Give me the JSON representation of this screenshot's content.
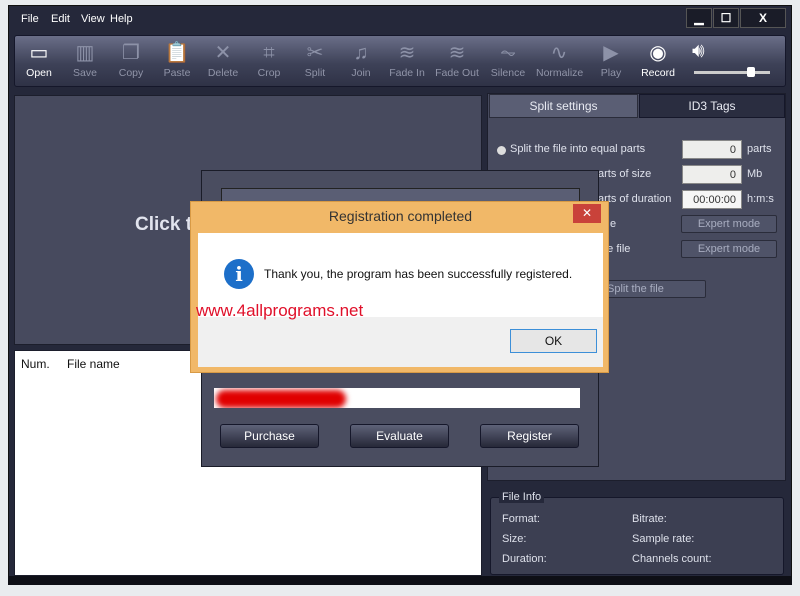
{
  "menu": [
    "File",
    "Edit",
    "View",
    "Help"
  ],
  "window_controls": {
    "minimize": "▁",
    "maximize": "☐",
    "close": "X"
  },
  "toolbar": [
    {
      "label": "Open",
      "icon": "folder-icon",
      "glyph": "▭",
      "enabled": true
    },
    {
      "label": "Save",
      "icon": "save-icon",
      "glyph": "▥",
      "enabled": false
    },
    {
      "label": "Copy",
      "icon": "copy-icon",
      "glyph": "❐",
      "enabled": false
    },
    {
      "label": "Paste",
      "icon": "paste-icon",
      "glyph": "📋",
      "enabled": false
    },
    {
      "label": "Delete",
      "icon": "delete-icon",
      "glyph": "✕",
      "enabled": false
    },
    {
      "label": "Crop",
      "icon": "crop-icon",
      "glyph": "⌗",
      "enabled": false
    },
    {
      "label": "Split",
      "icon": "scissors-icon",
      "glyph": "✂",
      "enabled": false
    },
    {
      "label": "Join",
      "icon": "join-icon",
      "glyph": "♫",
      "enabled": false
    },
    {
      "label": "Fade In",
      "icon": "fade-in-icon",
      "glyph": "≋",
      "enabled": false
    },
    {
      "label": "Fade Out",
      "icon": "fade-out-icon",
      "glyph": "≋",
      "enabled": false
    },
    {
      "label": "Silence",
      "icon": "silence-icon",
      "glyph": "⏦",
      "enabled": false
    },
    {
      "label": "Normalize",
      "icon": "normalize-icon",
      "glyph": "∿",
      "enabled": false
    },
    {
      "label": "Play",
      "icon": "play-icon",
      "glyph": "▶",
      "enabled": false
    },
    {
      "label": "Record",
      "icon": "record-icon",
      "glyph": "◉",
      "enabled": true
    }
  ],
  "volume": {
    "icon": "speaker-icon",
    "level": 0.75
  },
  "left_panel": {
    "prompt_fragment": "Click t"
  },
  "file_list": {
    "columns": [
      "Num.",
      "File name"
    ]
  },
  "right_panel": {
    "tabs": [
      "Split settings",
      "ID3 Tags"
    ],
    "active_tab": "Split settings",
    "option1": "Split the file into equal parts",
    "option2_fragment": "arts of size",
    "option3_fragment": "arts of duration",
    "option4_fragment": "e",
    "option5_fragment": "the file",
    "parts_value": "0",
    "parts_unit": "parts",
    "size_value": "0",
    "size_unit": "Mb",
    "duration_value": "00:00:00",
    "duration_unit": "h:m:s",
    "expert1": "Expert mode",
    "expert2": "Expert mode",
    "split_button": "Split the file"
  },
  "file_info": {
    "title": "File Info",
    "format": "Format:",
    "bitrate": "Bitrate:",
    "size": "Size:",
    "sample_rate": "Sample rate:",
    "duration": "Duration:",
    "channels": "Channels count:"
  },
  "register_dialog": {
    "purchase": "Purchase",
    "evaluate": "Evaluate",
    "register": "Register"
  },
  "message_box": {
    "title": "Registration completed",
    "message": "Thank you, the program has been successfully registered.",
    "ok": "OK",
    "close": "✕",
    "icon": "info-icon",
    "accent": "#f1b868"
  },
  "watermark": "www.4allprograms.net"
}
